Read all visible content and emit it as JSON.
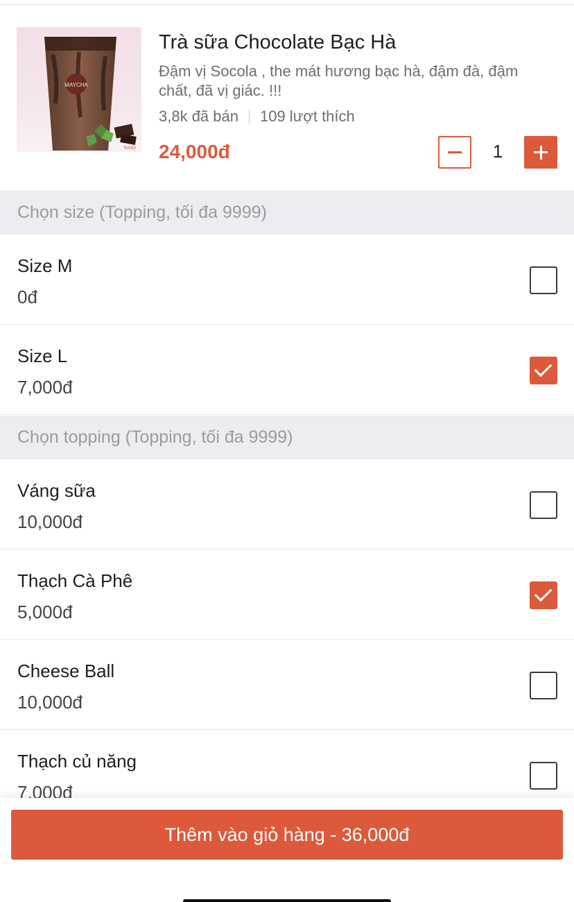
{
  "product": {
    "title": "Trà sữa Chocolate Bạc Hà",
    "description": "Đậm vị Socola , the mát hương bạc hà, đậm đà, đậm chất, đã vị giác. !!!",
    "sold": "3,8k đã bán",
    "likes": "109 lượt thích",
    "price": "24,000đ",
    "quantity": "1",
    "image_brand": "MAYCHA",
    "image_watermark": "foody"
  },
  "sections": [
    {
      "header": "Chọn size (Topping, tối đa 9999)",
      "options": [
        {
          "name": "Size M",
          "price": "0đ",
          "checked": false
        },
        {
          "name": "Size L",
          "price": "7,000đ",
          "checked": true
        }
      ]
    },
    {
      "header": "Chọn topping (Topping, tối đa 9999)",
      "options": [
        {
          "name": "Váng sữa",
          "price": "10,000đ",
          "checked": false
        },
        {
          "name": "Thạch Cà Phê",
          "price": "5,000đ",
          "checked": true
        },
        {
          "name": "Cheese Ball",
          "price": "10,000đ",
          "checked": false
        },
        {
          "name": "Thạch củ năng",
          "price": "7,000đ",
          "checked": false
        }
      ]
    }
  ],
  "cart_button": {
    "label": "Thêm vào giỏ hàng - 36,000đ"
  },
  "colors": {
    "accent": "#dc5a3b",
    "section_bg": "#ececf1",
    "section_text": "#9a9aa0"
  },
  "icons": {
    "minus": "minus-icon",
    "plus": "plus-icon",
    "check": "check-icon"
  }
}
